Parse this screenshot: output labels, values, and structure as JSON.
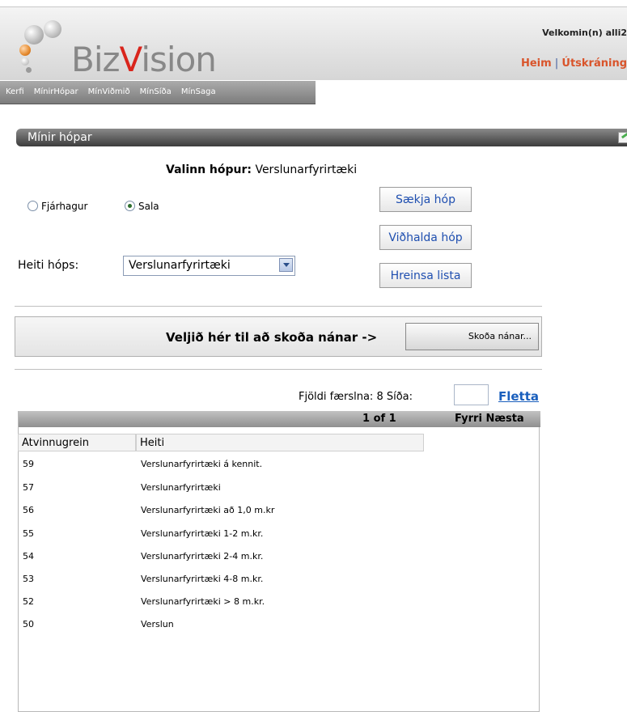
{
  "header": {
    "logo_prefix": "Biz",
    "logo_v": "V",
    "logo_suffix": "ision",
    "welcome": "Velkomin(n) alli2",
    "links": [
      "Heim",
      "Útskráning"
    ]
  },
  "nav": {
    "items": [
      "Kerfi",
      "MínirHópar",
      "MínViðmið",
      "MínSíða",
      "MínSaga"
    ]
  },
  "section": {
    "title": "Mínir hópar"
  },
  "selected_group": {
    "label": "Valinn hópur:",
    "value": "Verslunarfyrirtæki"
  },
  "type_options": [
    {
      "label": "Fjárhagur",
      "checked": false
    },
    {
      "label": "Sala",
      "checked": true
    }
  ],
  "buttons": {
    "fetch": "Sækja hóp",
    "maintain": "Viðhalda hóp",
    "clear": "Hreinsa lista"
  },
  "group_name": {
    "label": "Heiti hóps:",
    "selected": "Verslunarfyrirtæki"
  },
  "details_panel": {
    "text": "Veljið hér til að skoða nánar ->",
    "button": "Skoða nánar..."
  },
  "paging": {
    "count_text": "Fjöldi færslna: 8 Síða:",
    "page_input_value": "",
    "go_link": "Fletta",
    "page_info": "1 of 1",
    "prev": "Fyrri",
    "next": "Næsta"
  },
  "table": {
    "columns": [
      "Atvinnugrein",
      "Heiti"
    ],
    "rows": [
      [
        "59",
        "Verslunarfyrirtæki á kennit."
      ],
      [
        "57",
        "Verslunarfyrirtæki"
      ],
      [
        "56",
        "Verslunarfyrirtæki að 1,0 m.kr"
      ],
      [
        "55",
        "Verslunarfyrirtæki 1-2 m.kr."
      ],
      [
        "54",
        "Verslunarfyrirtæki 2-4 m.kr."
      ],
      [
        "53",
        "Verslunarfyrirtæki 4-8 m.kr."
      ],
      [
        "52",
        "Verslunarfyrirtæki > 8 m.kr."
      ],
      [
        "50",
        "Verslun"
      ]
    ]
  },
  "colors": {
    "accent_red": "#d9251c",
    "link_blue": "#1a5fbd",
    "button_text": "#1f4fb0"
  }
}
